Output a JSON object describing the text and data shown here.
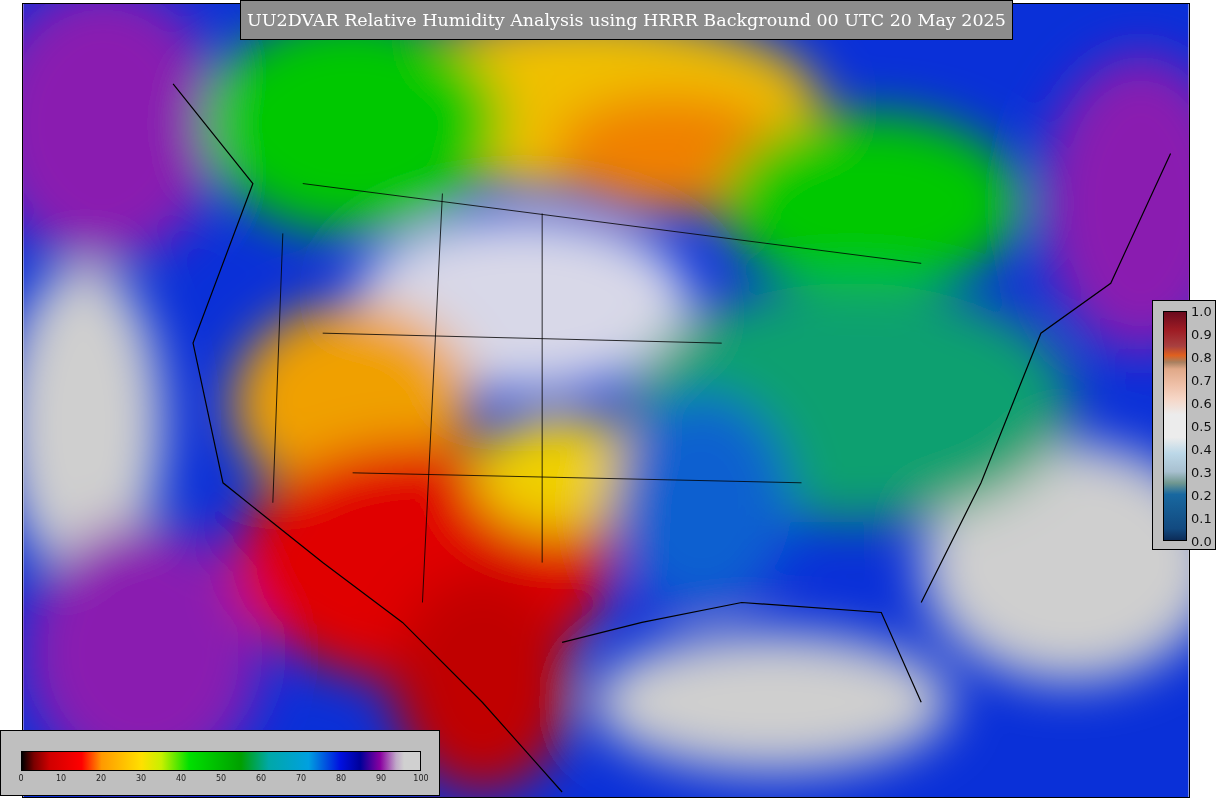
{
  "title": "UU2DVAR Relative Humidity Analysis using HRRR Background 00 UTC 20 May 2025",
  "analysis_colorbar": {
    "ticks": [
      "0",
      "10",
      "20",
      "30",
      "40",
      "50",
      "60",
      "70",
      "80",
      "90",
      "100"
    ]
  },
  "observation_colorbar": {
    "ticks": [
      "1.0",
      "0.9",
      "0.8",
      "0.7",
      "0.6",
      "0.5",
      "0.4",
      "0.3",
      "0.2",
      "0.1",
      "0.0"
    ]
  }
}
